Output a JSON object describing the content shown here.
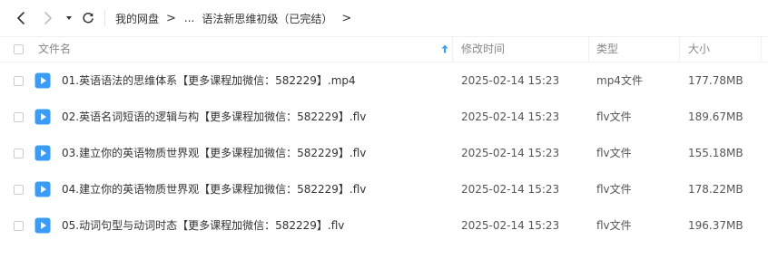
{
  "breadcrumb": {
    "items": [
      "我的网盘",
      "...",
      "语法新思维初级（已完结）"
    ],
    "separator": ">"
  },
  "table": {
    "headers": {
      "name": "文件名",
      "modified": "修改时间",
      "type": "类型",
      "size": "大小"
    },
    "rows": [
      {
        "name": "01.英语语法的思维体系【更多课程加微信：582229】.mp4",
        "modified": "2025-02-14 15:23",
        "type": "mp4文件",
        "size": "177.78MB"
      },
      {
        "name": "02.英语名词短语的逻辑与构【更多课程加微信：582229】.flv",
        "modified": "2025-02-14 15:23",
        "type": "flv文件",
        "size": "189.67MB"
      },
      {
        "name": "03.建立你的英语物质世界观【更多课程加微信：582229】.flv",
        "modified": "2025-02-14 15:23",
        "type": "flv文件",
        "size": "155.18MB"
      },
      {
        "name": "04.建立你的英语物质世界观【更多课程加微信：582229】.flv",
        "modified": "2025-02-14 15:23",
        "type": "flv文件",
        "size": "178.22MB"
      },
      {
        "name": "05.动词句型与动词时态【更多课程加微信：582229】.flv",
        "modified": "2025-02-14 15:23",
        "type": "flv文件",
        "size": "196.37MB"
      }
    ]
  },
  "colors": {
    "file_icon": "#3b9cf5",
    "sort_arrow": "#3b9cf5"
  },
  "icons": {
    "back": "chevron-left-icon",
    "forward": "chevron-right-icon",
    "history": "caret-down-icon",
    "refresh": "refresh-icon",
    "file": "video-file-icon",
    "sort": "sort-up-icon"
  }
}
